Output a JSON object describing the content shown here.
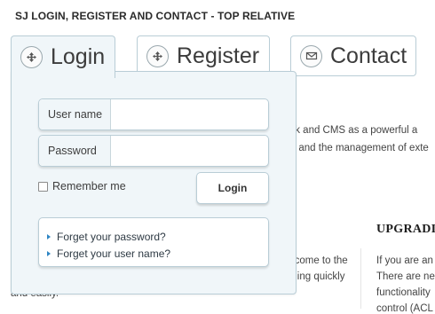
{
  "module_title": "SJ LOGIN, REGISTER AND CONTACT - TOP RELATIVE",
  "tabs": [
    {
      "label": "Login",
      "icon": "login-icon"
    },
    {
      "label": "Register",
      "icon": "register-icon"
    },
    {
      "label": "Contact",
      "icon": "contact-icon"
    }
  ],
  "login_form": {
    "username_label": "User name",
    "username_value": "",
    "password_label": "Password",
    "password_value": "",
    "remember_label": "Remember me",
    "remember_checked": false,
    "login_button": "Login",
    "links": [
      "Forget your password?",
      "Forget your user name?"
    ]
  },
  "background": {
    "line1": "ork and CMS as a powerful a",
    "line2": "t and the management of exte",
    "line3": "e come to the",
    "line4": "nning quickly",
    "line5": "and easily.",
    "heading": "UPGRADI",
    "side1": "If you are an",
    "side2": "There are ne",
    "side3": "functionality",
    "side4": "control (ACL"
  },
  "colors": {
    "panel_bg": "#f0f6f9",
    "border": "#b9cdd6",
    "link_bullet": "#2f86c4"
  }
}
